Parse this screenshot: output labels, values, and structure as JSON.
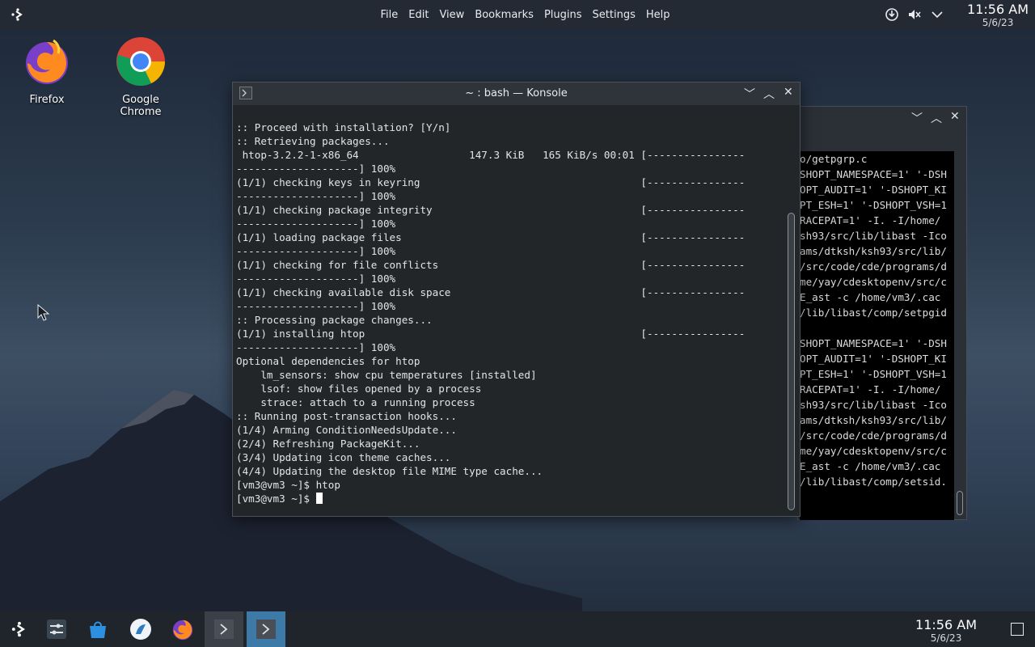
{
  "menubar": {
    "items": [
      "File",
      "Edit",
      "View",
      "Bookmarks",
      "Plugins",
      "Settings",
      "Help"
    ]
  },
  "tray": {
    "icons": [
      "network-update-icon",
      "volume-muted-icon",
      "chevron-down-icon"
    ]
  },
  "clock": {
    "time": "11:56 AM",
    "date": "5/6/23"
  },
  "desktop": {
    "icons": [
      {
        "label": "Firefox"
      },
      {
        "label": "Google Chrome"
      }
    ]
  },
  "konsole": {
    "title": "~ : bash — Konsole",
    "lines": [
      ":: Proceed with installation? [Y/n]",
      ":: Retrieving packages...",
      " htop-3.2.2-1-x86_64                  147.3 KiB   165 KiB/s 00:01 [----------------",
      "--------------------] 100%",
      "(1/1) checking keys in keyring                                    [----------------",
      "--------------------] 100%",
      "(1/1) checking package integrity                                  [----------------",
      "--------------------] 100%",
      "(1/1) loading package files                                       [----------------",
      "--------------------] 100%",
      "(1/1) checking for file conflicts                                 [----------------",
      "--------------------] 100%",
      "(1/1) checking available disk space                               [----------------",
      "--------------------] 100%",
      ":: Processing package changes...",
      "(1/1) installing htop                                             [----------------",
      "--------------------] 100%",
      "Optional dependencies for htop",
      "    lm_sensors: show cpu temperatures [installed]",
      "    lsof: show files opened by a process",
      "    strace: attach to a running process",
      ":: Running post-transaction hooks...",
      "(1/4) Arming ConditionNeedsUpdate...",
      "(2/4) Refreshing PackageKit...",
      "(3/4) Updating icon theme caches...",
      "(4/4) Updating the desktop file MIME type cache...",
      "[vm3@vm3 ~]$ htop"
    ],
    "prompt": "[vm3@vm3 ~]$ "
  },
  "background_terminal": {
    "lines": [
      "o/getpgrp.c",
      "SHOPT_NAMESPACE=1' '-DSH",
      "OPT_AUDIT=1' '-DSHOPT_KI",
      "PT_ESH=1' '-DSHOPT_VSH=1",
      "RACEPAT=1' -I. -I/home/",
      "sh93/src/lib/libast -Ico",
      "ams/dtksh/ksh93/src/lib/",
      "/src/code/cde/programs/d",
      "me/yay/cdesktopenv/src/c",
      "E_ast -c /home/vm3/.cac",
      "/lib/libast/comp/setpgid",
      "",
      "SHOPT_NAMESPACE=1' '-DSH",
      "OPT_AUDIT=1' '-DSHOPT_KI",
      "PT_ESH=1' '-DSHOPT_VSH=1",
      "RACEPAT=1' -I. -I/home/",
      "sh93/src/lib/libast -Ico",
      "ams/dtksh/ksh93/src/lib/",
      "/src/code/cde/programs/d",
      "me/yay/cdesktopenv/src/c",
      "E_ast -c /home/vm3/.cac",
      "/lib/libast/comp/setsid."
    ]
  },
  "taskbar": {
    "items": [
      "application-launcher-icon",
      "system-settings-icon",
      "discover-store-icon",
      "bird-app-icon",
      "firefox-icon",
      "terminal-icon",
      "terminal-icon"
    ],
    "clock": {
      "time": "11:56 AM",
      "date": "5/6/23"
    }
  }
}
